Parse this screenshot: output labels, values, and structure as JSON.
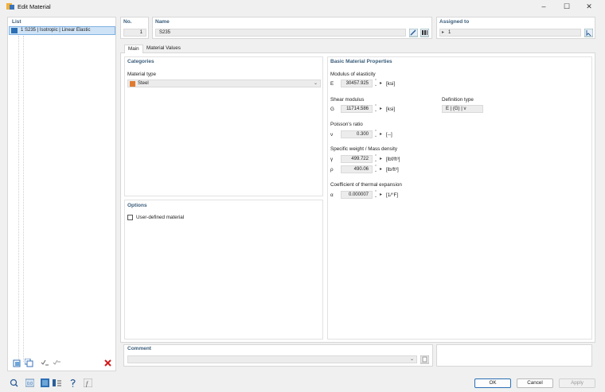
{
  "window": {
    "title": "Edit Material",
    "minimize": "–",
    "maximize": "☐",
    "close": "✕"
  },
  "list": {
    "header": "List",
    "items": [
      {
        "label": "1  S235 | Isotropic | Linear Elastic"
      }
    ]
  },
  "no": {
    "header": "No.",
    "value": "1"
  },
  "name": {
    "header": "Name",
    "value": "S235"
  },
  "assigned": {
    "header": "Assigned to",
    "value": "1"
  },
  "tabs": [
    {
      "label": "Main"
    },
    {
      "label": "Material Values"
    }
  ],
  "categories": {
    "header": "Categories",
    "material_type_label": "Material type",
    "material_type_value": "Steel",
    "material_color": "#e07a2e"
  },
  "options": {
    "header": "Options",
    "user_defined_label": "User-defined material"
  },
  "props": {
    "header": "Basic Material Properties",
    "modulus": {
      "label": "Modulus of elasticity",
      "sym": "E",
      "value": "30457.925",
      "unit": "[ksi]"
    },
    "shear": {
      "label": "Shear modulus",
      "sym": "G",
      "value": "11714.586",
      "unit": "[ksi]"
    },
    "definition": {
      "label": "Definition type",
      "value": "E | (G) | ν"
    },
    "poisson": {
      "label": "Poisson's ratio",
      "sym": "ν",
      "value": "0.300",
      "unit": "[--]"
    },
    "weight": {
      "label": "Specific weight / Mass density",
      "gamma_sym": "γ",
      "gamma_value": "499.722",
      "gamma_unit": "[lbf/ft³]",
      "rho_sym": "ρ",
      "rho_value": "490.06",
      "rho_unit": "[lb/ft³]"
    },
    "thermal": {
      "label": "Coefficient of thermal expansion",
      "sym": "α",
      "value": "0.000007",
      "unit": "[1/°F]"
    }
  },
  "comment": {
    "header": "Comment"
  },
  "buttons": {
    "ok": "OK",
    "cancel": "Cancel",
    "apply": "Apply"
  }
}
